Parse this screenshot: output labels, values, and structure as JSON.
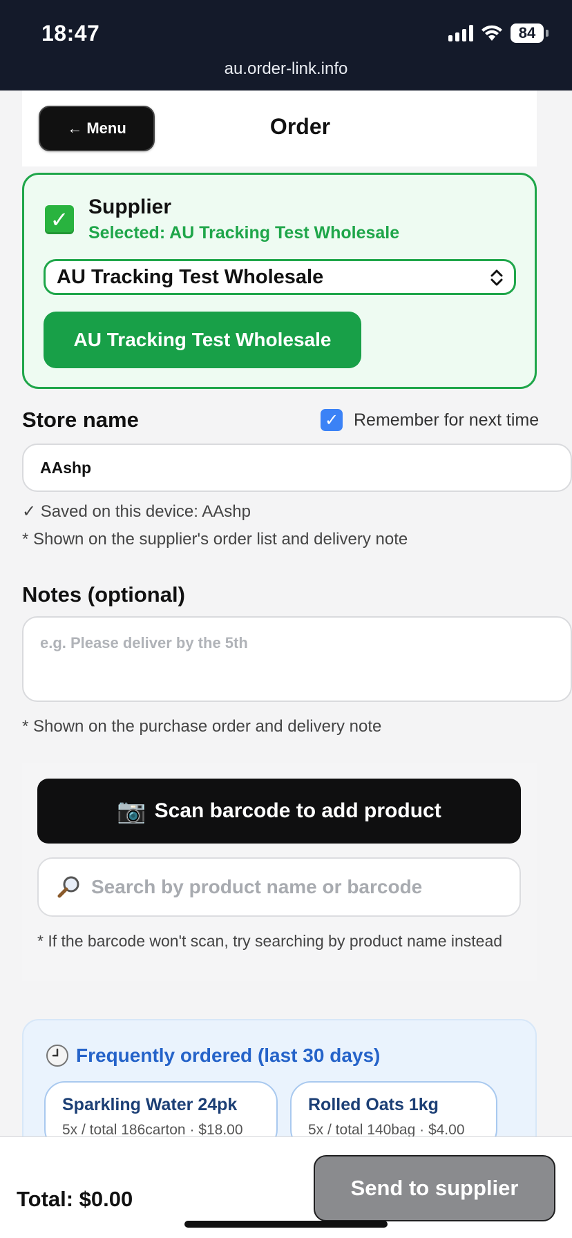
{
  "status_bar": {
    "time": "18:47",
    "battery": "84",
    "url": "au.order-link.info",
    "icons": [
      "signal-icon",
      "wifi-icon",
      "battery-icon"
    ]
  },
  "header": {
    "menu_label": "← Menu",
    "title": "Order"
  },
  "supplier": {
    "heading": "Supplier",
    "selected_text": "Selected: AU Tracking Test Wholesale",
    "select_value": "AU Tracking Test Wholesale",
    "button_label": "AU Tracking Test Wholesale",
    "accent_color": "#1fa64a"
  },
  "store": {
    "label": "Store name",
    "remember_label": "Remember for next time",
    "remember_checked": true,
    "value": "AAshp",
    "saved_text": "✓ Saved on this device: AAshp",
    "hint": "* Shown on the supplier's order list and delivery note"
  },
  "notes": {
    "label": "Notes (optional)",
    "placeholder": "e.g. Please deliver by the 5th",
    "hint": "* Shown on the purchase order and delivery note"
  },
  "scan": {
    "button_label": "Scan barcode to add product",
    "camera_icon": "📷",
    "search_placeholder": "Search by product name or barcode",
    "hint": "* If the barcode won't scan, try searching by product name instead"
  },
  "frequent": {
    "title": "Frequently ordered (last 30 days)",
    "items": [
      {
        "name": "Sparkling Water 24pk",
        "meta": "5x / total 186carton · $18.00"
      },
      {
        "name": "Rolled Oats 1kg",
        "meta": "5x / total 140bag · $4.00"
      }
    ]
  },
  "footer": {
    "total": "Total: $0.00",
    "send_label": "Send to supplier"
  }
}
